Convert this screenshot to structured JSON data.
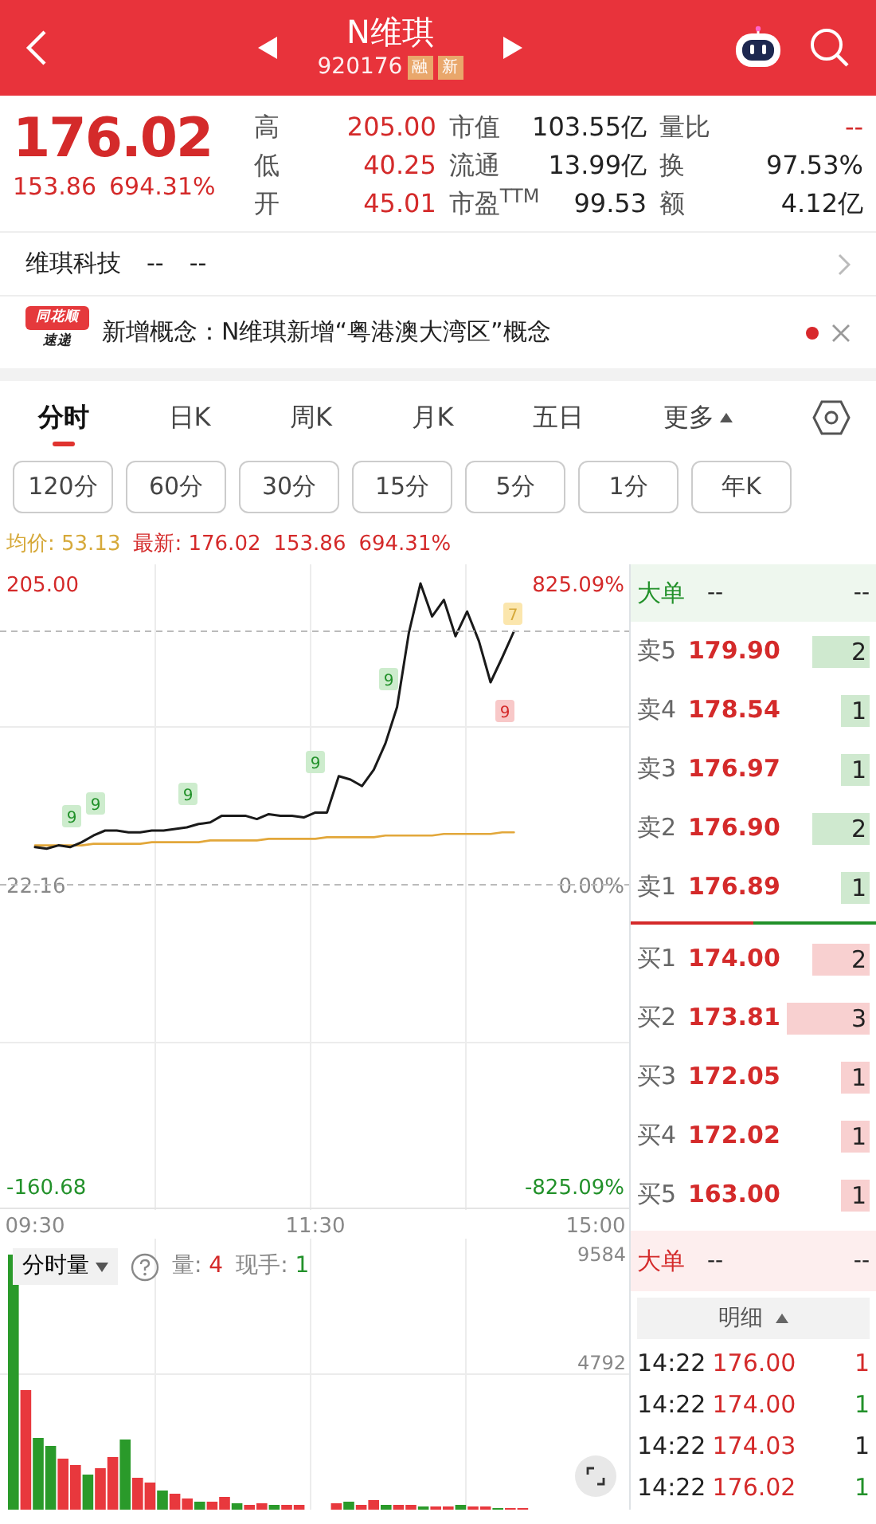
{
  "header": {
    "title": "N维琪",
    "code": "920176",
    "tags": [
      "融",
      "新"
    ]
  },
  "quote": {
    "price": "176.02",
    "change": "153.86",
    "change_pct": "694.31%",
    "columns": [
      [
        {
          "label": "高",
          "value": "205.00",
          "kind": "up"
        },
        {
          "label": "低",
          "value": "40.25",
          "kind": "up"
        },
        {
          "label": "开",
          "value": "45.01",
          "kind": "up"
        }
      ],
      [
        {
          "label": "市值",
          "value": "103.55亿",
          "kind": "flat"
        },
        {
          "label": "流通",
          "value": "13.99亿",
          "kind": "flat"
        },
        {
          "label": "市盈$^{TTM}$",
          "value": "99.53",
          "kind": "flat"
        }
      ],
      [
        {
          "label": "量比",
          "value": "--",
          "kind": "up"
        },
        {
          "label": "换",
          "value": "97.53%",
          "kind": "flat"
        },
        {
          "label": "额",
          "value": "4.12亿",
          "kind": "flat"
        }
      ]
    ]
  },
  "company": {
    "name": "维琪科技",
    "values": [
      "--",
      "--"
    ]
  },
  "news": {
    "logo_lines": [
      "同花顺",
      "速递"
    ],
    "text": "新增概念：N维琪新增“粤港澳大湾区”概念",
    "unread": true
  },
  "tabs": [
    {
      "label": "分时",
      "selected": true,
      "kind": "tab"
    },
    {
      "label": "日K",
      "selected": false,
      "kind": "tab"
    },
    {
      "label": "周K",
      "selected": false,
      "kind": "tab"
    },
    {
      "label": "月K",
      "selected": false,
      "kind": "tab"
    },
    {
      "label": "五日",
      "selected": false,
      "kind": "tab"
    },
    {
      "label": "更多",
      "selected": false,
      "kind": "menu"
    }
  ],
  "periods": [
    "120分",
    "60分",
    "30分",
    "15分",
    "5分",
    "1分",
    "年K"
  ],
  "legend": {
    "avg_label": "均价:",
    "avg": "53.13",
    "latest_label": "最新:",
    "latest": "176.02",
    "change": "153.86",
    "change_pct": "694.31%"
  },
  "price_chart": {
    "right_axis": [
      "825.09%",
      "0.00%",
      "-825.09%"
    ],
    "signal_tags": [
      {
        "text": "9",
        "kind": "buy"
      },
      {
        "text": "9",
        "kind": "buy"
      },
      {
        "text": "9",
        "kind": "buy"
      },
      {
        "text": "9",
        "kind": "buy"
      },
      {
        "text": "9",
        "kind": "buy"
      },
      {
        "text": "9",
        "kind": "sell"
      },
      {
        "text": "7",
        "kind": "pending"
      }
    ],
    "chart_data": {
      "type": "line",
      "categories": [
        "09:30",
        null,
        null,
        null,
        null,
        null,
        null,
        null,
        null,
        null,
        null,
        null,
        null,
        null,
        null,
        null,
        null,
        null,
        null,
        null,
        null,
        null,
        null,
        null,
        "11:30",
        null,
        null,
        null,
        null,
        null,
        null,
        null,
        null,
        null,
        null,
        null,
        null,
        null,
        null,
        null,
        null,
        null,
        null,
        null,
        null,
        null,
        null,
        null,
        "15:00"
      ],
      "series": [
        {
          "color": "#1a1a1a",
          "values": [
            45,
            44,
            46,
            45,
            48,
            52,
            55,
            55,
            54,
            54,
            55,
            55,
            56,
            57,
            59,
            60,
            64,
            64,
            64,
            62,
            65,
            64,
            64,
            63,
            66,
            66,
            88,
            86,
            82,
            92,
            108,
            130,
            175,
            205,
            185,
            195,
            173,
            188,
            170,
            145,
            160,
            176,
            null,
            null,
            null,
            null,
            null,
            null,
            null
          ]
        },
        {
          "color": "#e2a73a",
          "values": [
            46,
            46,
            46,
            46,
            46,
            47,
            47,
            47,
            47,
            47,
            48,
            48,
            48,
            48,
            48,
            49,
            49,
            49,
            49,
            49,
            50,
            50,
            50,
            50,
            50,
            51,
            51,
            51,
            51,
            51,
            52,
            52,
            52,
            52,
            52,
            53,
            53,
            53,
            53,
            53,
            54,
            54,
            null,
            null,
            null,
            null,
            null,
            null,
            null
          ]
        }
      ],
      "ylim": [
        -175.2,
        216.6
      ],
      "yticks": [
        {
          "value": 205,
          "label": "205.00"
        },
        {
          "value": 22.16,
          "label": "22.16"
        },
        {
          "value": -160.68,
          "label": "-160.68"
        }
      ]
    }
  },
  "book": {
    "big_order": {
      "label": "大单",
      "values": [
        "--",
        "--"
      ]
    },
    "asks": [
      {
        "label": "卖5",
        "price": "179.90",
        "qty": "2"
      },
      {
        "label": "卖4",
        "price": "178.54",
        "qty": "1"
      },
      {
        "label": "卖3",
        "price": "176.97",
        "qty": "1"
      },
      {
        "label": "卖2",
        "price": "176.90",
        "qty": "2"
      },
      {
        "label": "卖1",
        "price": "176.89",
        "qty": "1"
      }
    ],
    "bids": [
      {
        "label": "买1",
        "price": "174.00",
        "qty": "2"
      },
      {
        "label": "买2",
        "price": "173.81",
        "qty": "3"
      },
      {
        "label": "买3",
        "price": "172.05",
        "qty": "1"
      },
      {
        "label": "买4",
        "price": "172.02",
        "qty": "1"
      },
      {
        "label": "买5",
        "price": "163.00",
        "qty": "1"
      }
    ]
  },
  "volume": {
    "selector": "分时量",
    "vol_label": "量:",
    "vol": "4",
    "hand_label": "现手:",
    "hand": "1",
    "axis_labels": [
      "9584",
      "4792"
    ]
  },
  "lower_book": {
    "big_order": {
      "label": "大单",
      "values": [
        "--",
        "--"
      ]
    },
    "detail_label": "明细",
    "trades": [
      {
        "time": "14:22",
        "price": "176.00",
        "qty": "1",
        "color": "#d42a2a"
      },
      {
        "time": "14:22",
        "price": "174.00",
        "qty": "1",
        "color": "#22912a"
      },
      {
        "time": "14:22",
        "price": "174.03",
        "qty": "1",
        "color": "#222222"
      },
      {
        "time": "14:22",
        "price": "176.02",
        "qty": "1",
        "color": "#22912a"
      }
    ]
  }
}
